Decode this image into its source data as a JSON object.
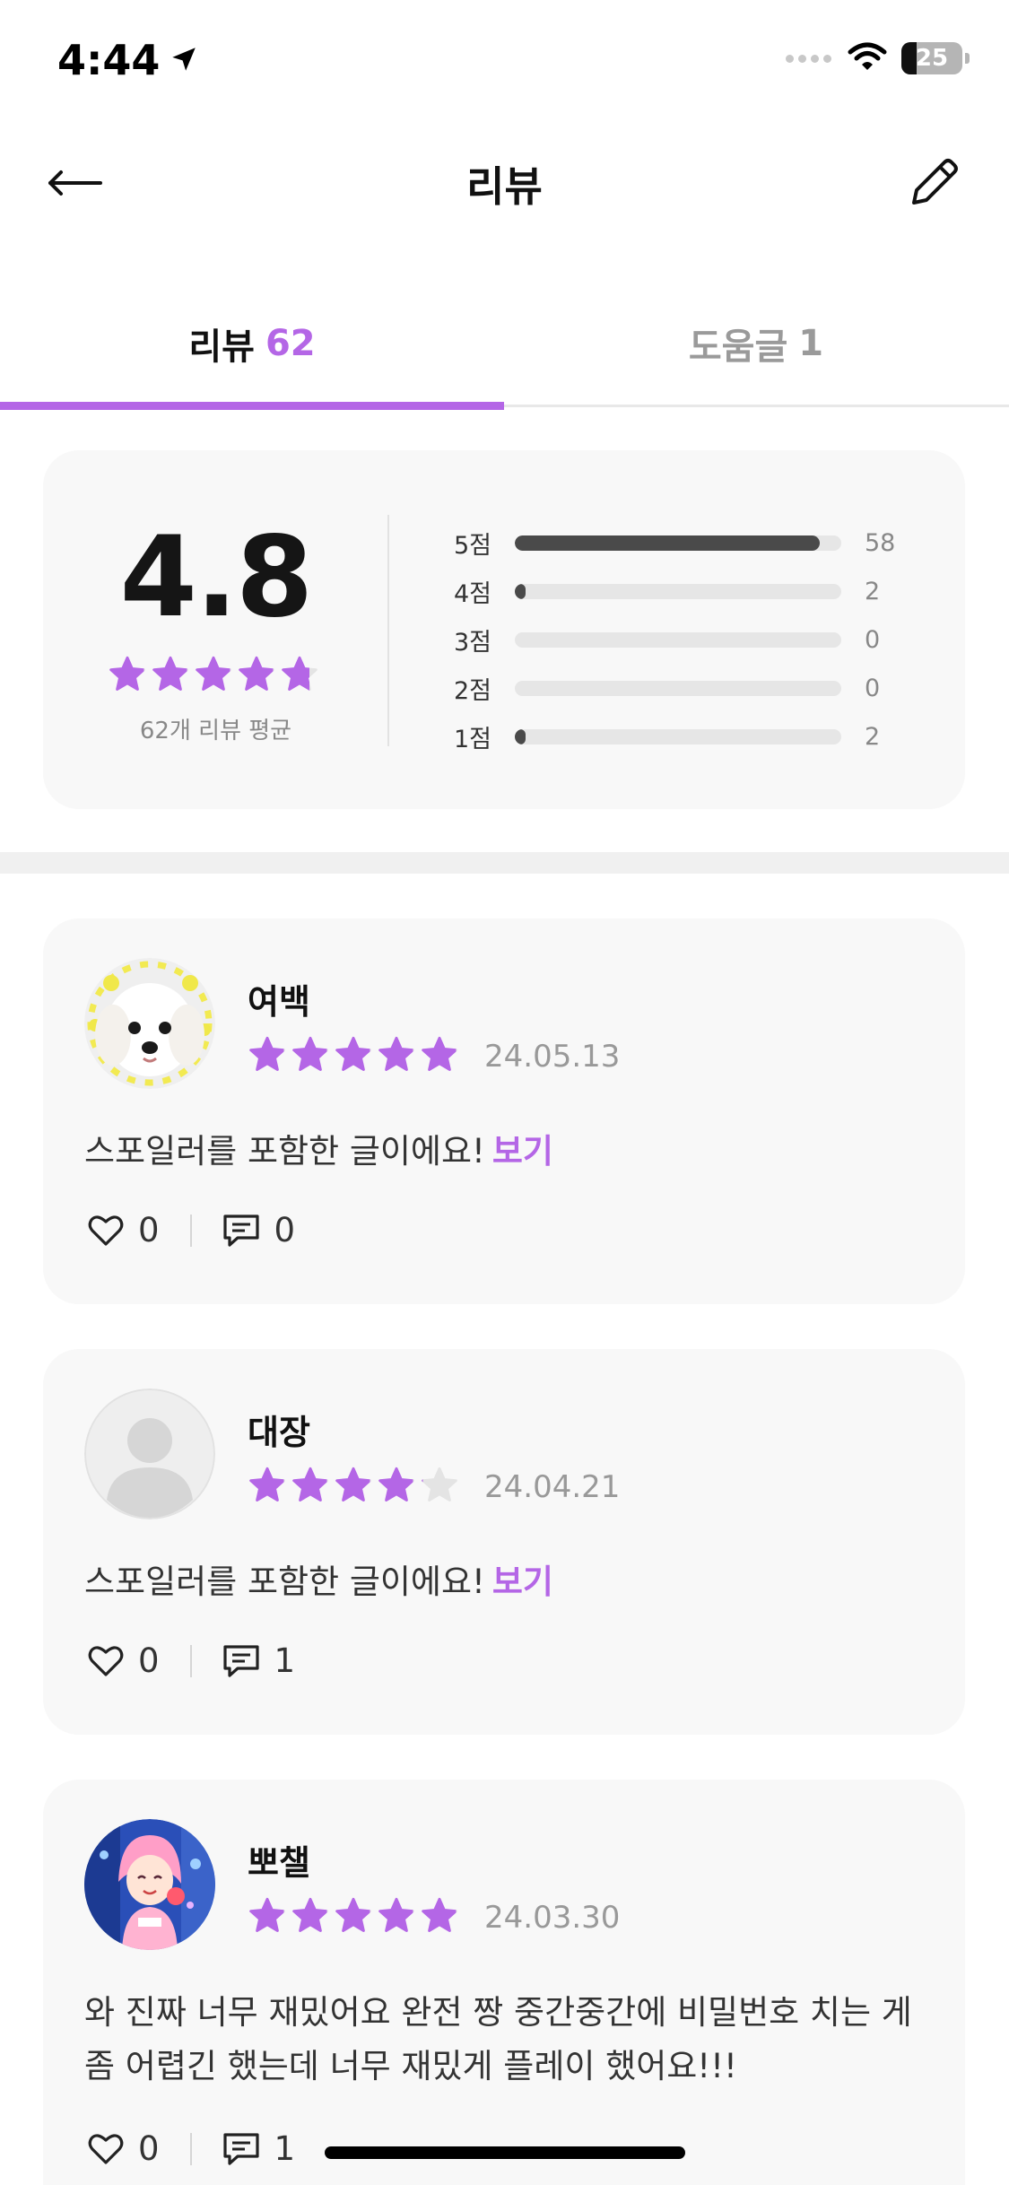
{
  "status_bar": {
    "time": "4:44",
    "battery": "25",
    "icons": [
      "location-arrow-icon",
      "signal-icon",
      "wifi-icon",
      "battery-icon"
    ]
  },
  "header": {
    "title": "리뷰",
    "back_icon": "arrow-left-icon",
    "edit_icon": "pencil-icon"
  },
  "tabs": [
    {
      "label": "리뷰",
      "count": "62",
      "active": true
    },
    {
      "label": "도움글",
      "count": "1",
      "active": false
    }
  ],
  "summary": {
    "average": "4.8",
    "average_value": 4.8,
    "caption": "62개 리뷰 평균",
    "distribution": [
      {
        "label": "5점",
        "count": "58",
        "fraction": 0.935
      },
      {
        "label": "4점",
        "count": "2",
        "fraction": 0.032
      },
      {
        "label": "3점",
        "count": "0",
        "fraction": 0
      },
      {
        "label": "2점",
        "count": "0",
        "fraction": 0
      },
      {
        "label": "1점",
        "count": "2",
        "fraction": 0.032
      }
    ]
  },
  "reviews": [
    {
      "username": "여백",
      "rating": 5,
      "date": "24.05.13",
      "body": "스포일러를 포함한 글이에요!",
      "spoiler_link": "보기",
      "likes": "0",
      "comments": "0",
      "avatar": "dog-photo-avatar"
    },
    {
      "username": "대장",
      "rating": 4,
      "date": "24.04.21",
      "body": "스포일러를 포함한 글이에요!",
      "spoiler_link": "보기",
      "likes": "0",
      "comments": "1",
      "avatar": "default-person-avatar"
    },
    {
      "username": "뽀챌",
      "rating": 5,
      "date": "24.03.30",
      "body": "와 진짜 너무 재밌어요 완전 짱 중간중간에 비밀번호 치는 게 좀 어렵긴 했는데 너무 재밌게 플레이 했어요!!!",
      "spoiler_link": "",
      "likes": "0",
      "comments": "1",
      "avatar": "anime-character-avatar"
    }
  ],
  "colors": {
    "accent": "#b466e6",
    "star_empty": "#e4e4e4",
    "bar_fill": "#4a4a4a",
    "bar_track": "#e6e6e6",
    "card_bg": "#f8f8f8"
  }
}
